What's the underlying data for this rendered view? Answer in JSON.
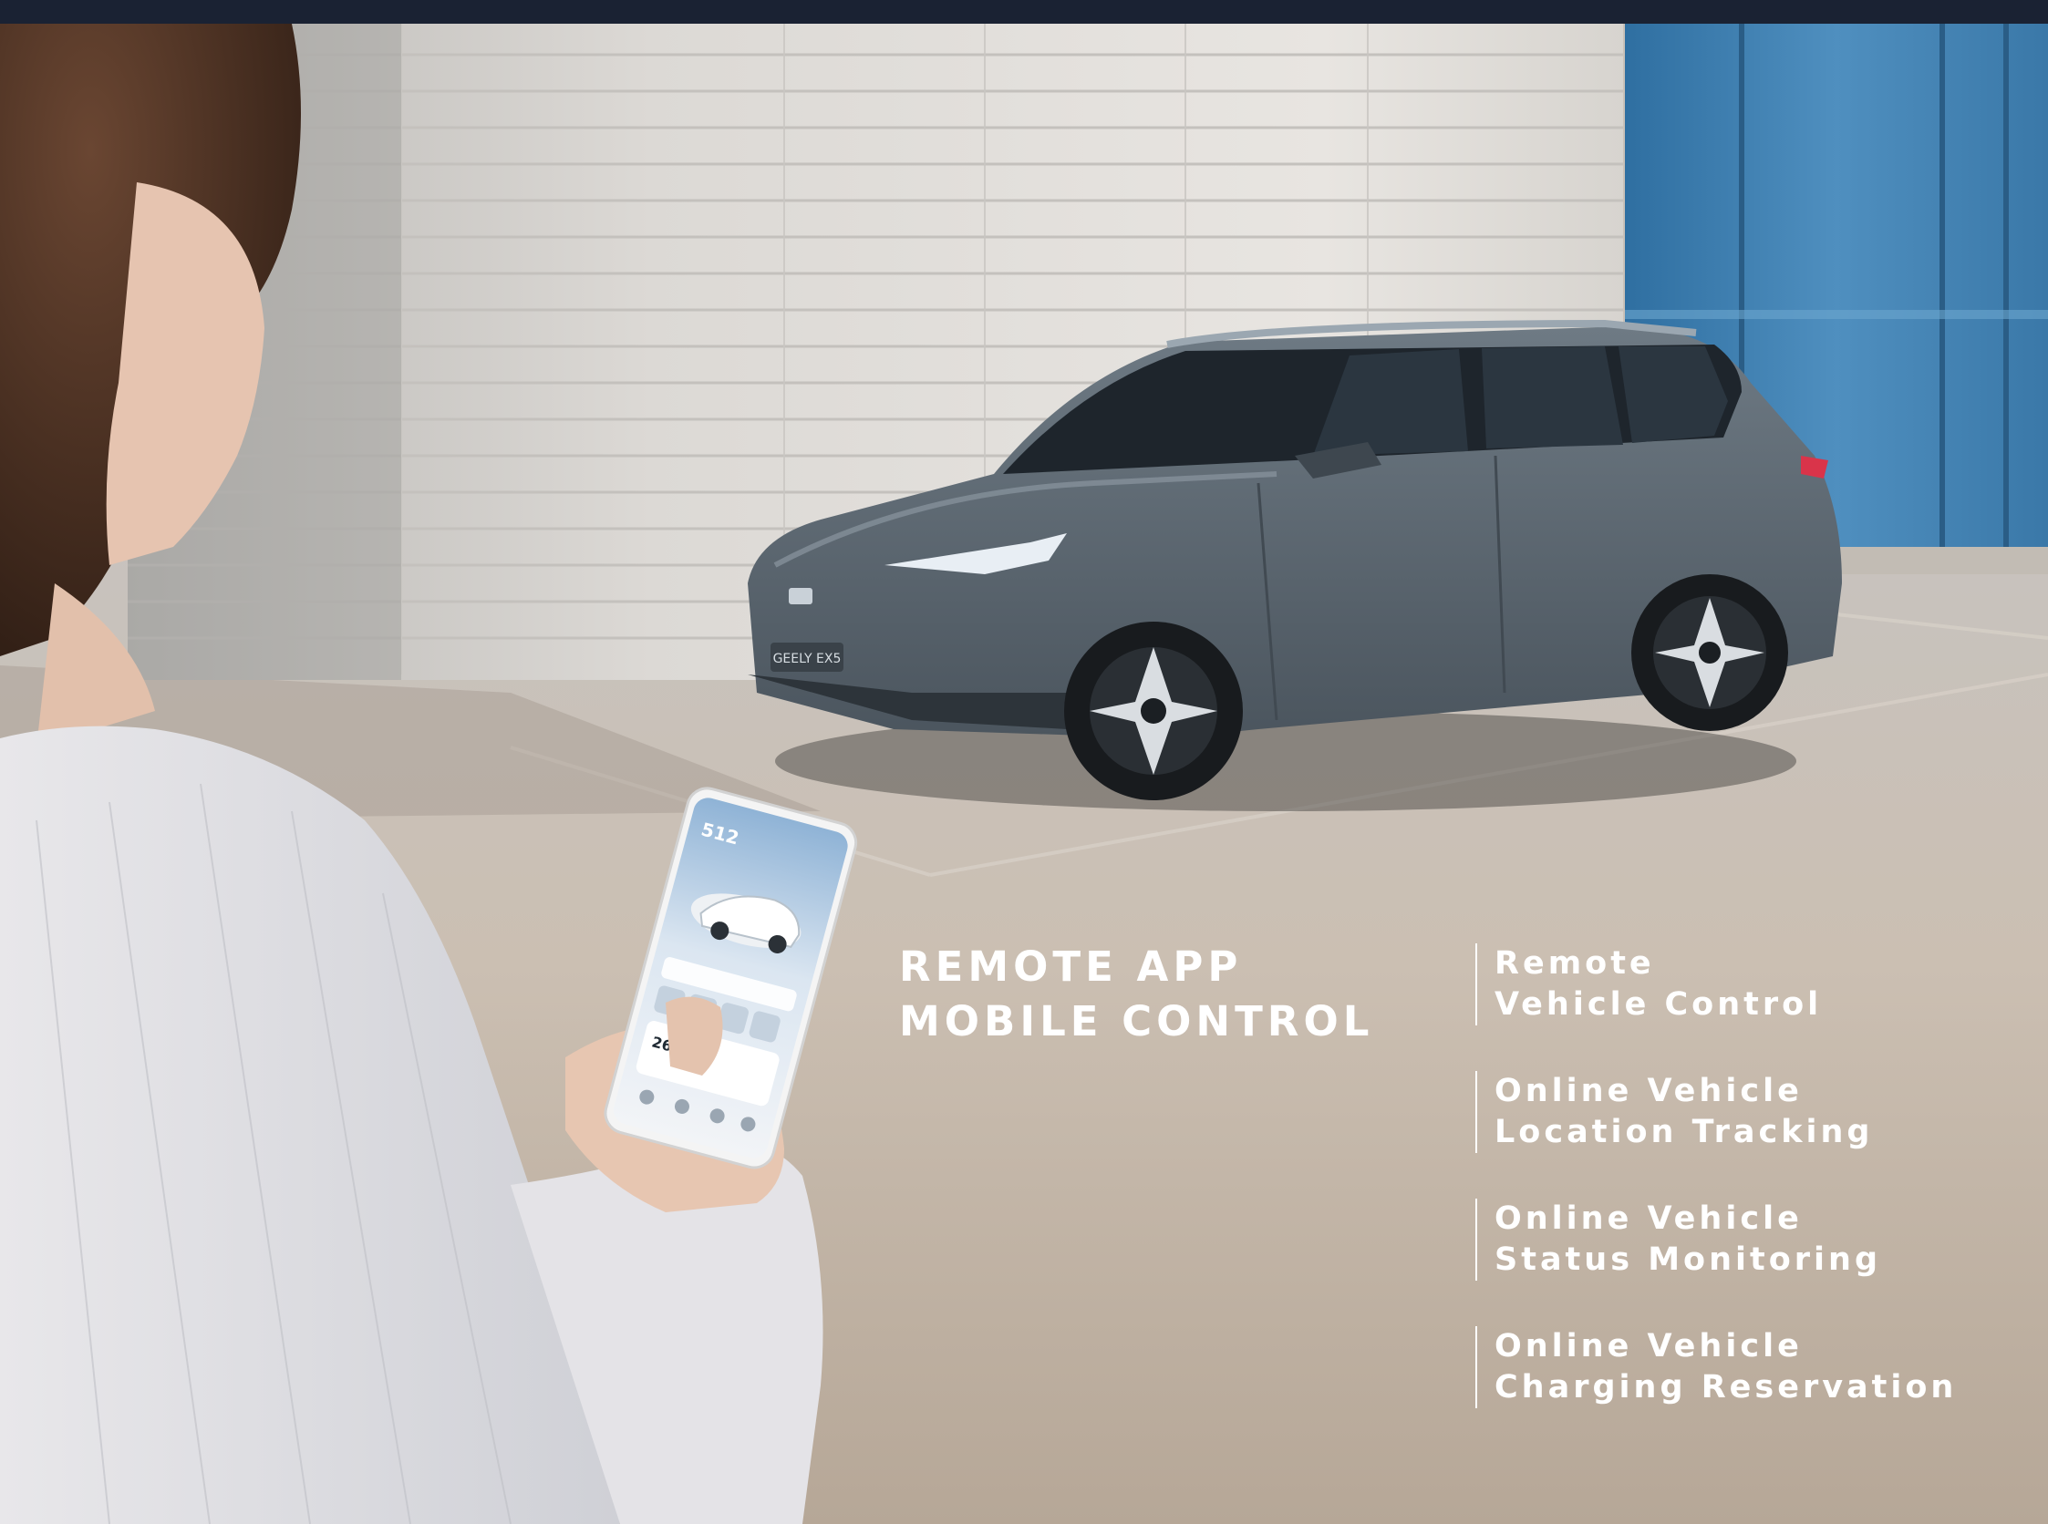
{
  "headline": {
    "line1": "REMOTE APP",
    "line2": "MOBILE CONTROL"
  },
  "features": [
    {
      "line1": "Remote",
      "line2": "Vehicle Control"
    },
    {
      "line1": "Online Vehicle",
      "line2": "Location Tracking"
    },
    {
      "line1": "Online Vehicle",
      "line2": "Status Monitoring"
    },
    {
      "line1": "Online Vehicle",
      "line2": "Charging Reservation"
    }
  ],
  "car": {
    "badge": "GEELY EX5"
  },
  "phone": {
    "range": "512",
    "temperature": "26"
  },
  "colors": {
    "car_body": "#5b6670",
    "building": "#d9d6d2",
    "glass": "#3f7fae",
    "ground": "#bfb4a8",
    "text": "#ffffff"
  }
}
